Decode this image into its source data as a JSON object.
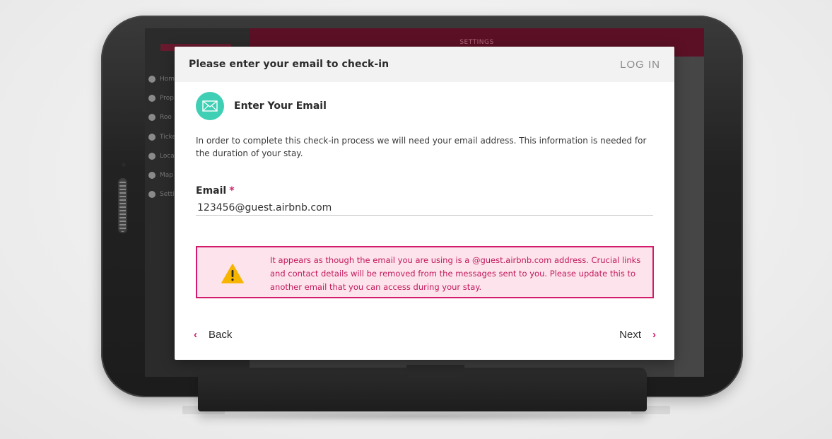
{
  "device": {
    "screen_header": "SETTINGS",
    "nav_items": [
      "Home",
      "Prop",
      "Roo",
      "Ticke",
      "Loca",
      "Map",
      "Setti"
    ]
  },
  "modal": {
    "title": "Please enter your email to check-in",
    "login_label": "LOG IN",
    "section_icon": "envelope-icon",
    "section_title": "Enter Your Email",
    "intro": "In order to complete this check-in process we will need your email address. This information is needed for the duration of your stay.",
    "email_label": "Email",
    "required_marker": "*",
    "email_value": "123456@guest.airbnb.com",
    "alert_icon": "warning-triangle-icon",
    "alert_text": "It appears as though the email you are using is a @guest.airbnb.com address. Crucial links and contact details will be removed from the messages sent to you. Please update this to another email that you can access during your stay.",
    "back_label": "Back",
    "next_label": "Next"
  },
  "colors": {
    "accent": "#d21c6b",
    "alert_bg": "#fde4ec",
    "icon_circle": "#3fcfb4",
    "header_bg": "#f2f2f2",
    "device_header": "#5c1025"
  }
}
